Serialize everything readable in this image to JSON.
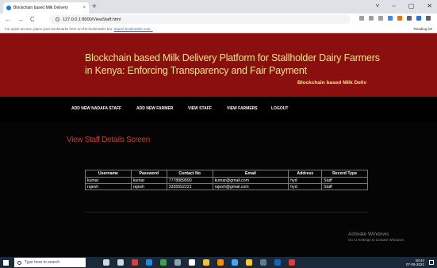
{
  "browser": {
    "tab_title": "Blockchain based Milk Delivery",
    "tab_close": "×",
    "new_tab": "+",
    "window_controls": [
      "˅",
      "–",
      "▢",
      "✕"
    ],
    "url": "127.0.0.1:8000/ViewStaff.html",
    "nav": [
      "←",
      "→",
      "C"
    ],
    "bookmark_prefix": "For quick access, place your bookmarks here on the bookmarks bar.",
    "bookmark_link": "Import bookmarks now...",
    "reading_list": "Reading list"
  },
  "banner": {
    "title_line1": "Blockchain based Milk Delivery Platform for Stallholder Dairy Farmers",
    "title_line2": "in Kenya: Enforcing Transparency and Fair Payment",
    "marquee": "Blockchain based Milk Deliv"
  },
  "menu": [
    "ADD NEW NADAFA STAFF",
    "ADD NEW FARMER",
    "VIEW STAFF",
    "VIEW FARMERS",
    "LOGOUT"
  ],
  "page": {
    "heading": "View Staff Details Screen"
  },
  "table": {
    "headers": [
      "Username",
      "Password",
      "Contact No",
      "Email",
      "Address",
      "Record Type"
    ],
    "rows": [
      [
        "kumar",
        "kumar",
        "7778889990",
        "kumar@gmail.com",
        "hyd",
        "Staff"
      ],
      [
        "rajesh",
        "rajesh",
        "3335552221",
        "rajesh@gmail.com",
        "hyd",
        "Staff"
      ]
    ]
  },
  "watermark": {
    "line1": "Activate Windows",
    "line2": "Go to Settings to activate Windows."
  },
  "taskbar": {
    "search_placeholder": "Type here to search",
    "time": "18:44",
    "date": "07-05-2022"
  },
  "colors": {
    "banner_bg": "#8b0f0f",
    "banner_text": "#f4e08c",
    "heading": "#c93f2d",
    "page_bg": "#000000"
  }
}
